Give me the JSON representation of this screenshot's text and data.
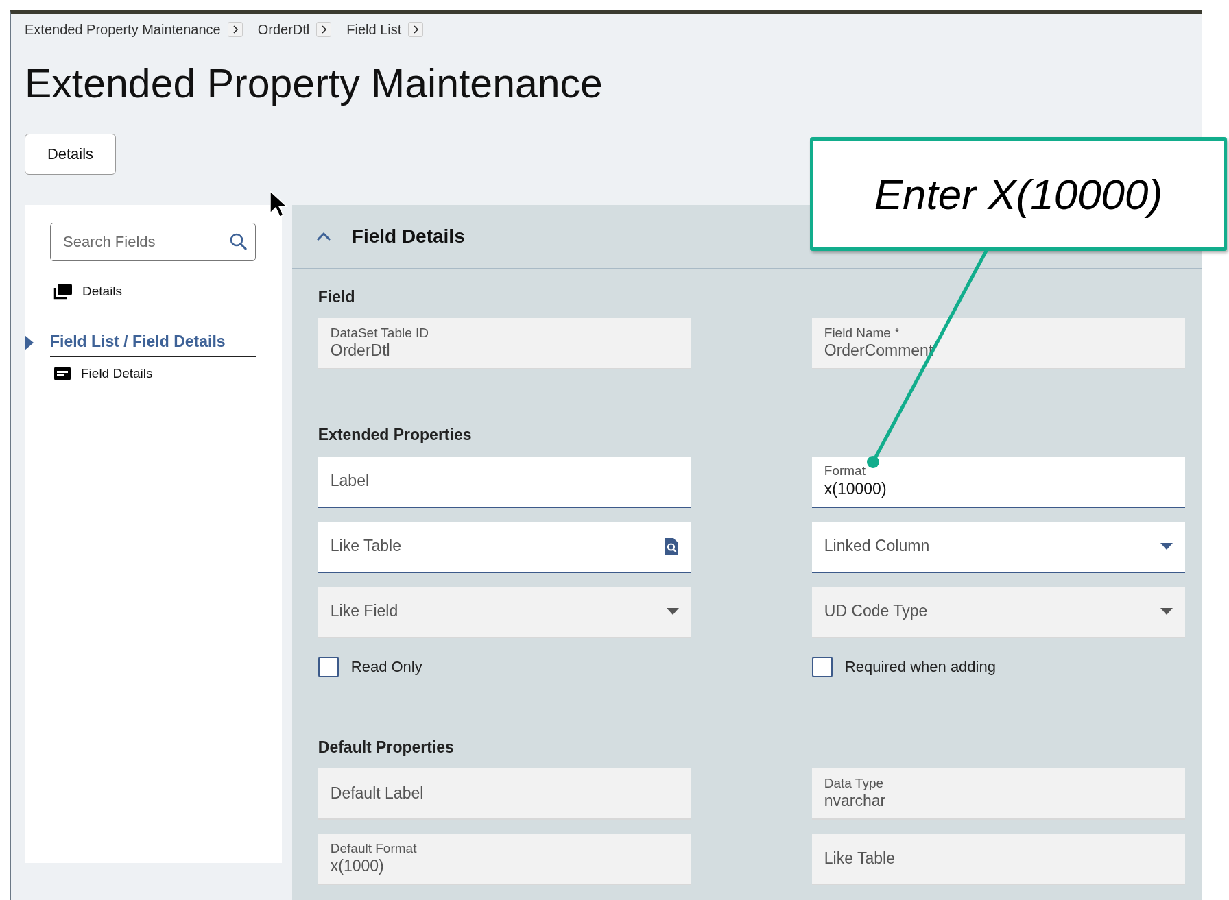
{
  "breadcrumbs": [
    {
      "label": "Extended Property Maintenance"
    },
    {
      "label": "OrderDtl"
    },
    {
      "label": "Field List"
    }
  ],
  "page_title": "Extended Property Maintenance",
  "details_button": "Details",
  "sidebar": {
    "search": {
      "placeholder": "Search Fields"
    },
    "items": [
      {
        "kind": "link",
        "label": "Details"
      },
      {
        "kind": "group",
        "label": "Field List / Field Details",
        "selected": true,
        "children": [
          {
            "kind": "form",
            "label": "Field Details"
          }
        ]
      }
    ]
  },
  "panel": {
    "title": "Field Details",
    "expanded": true,
    "sections": [
      {
        "title": "Field",
        "fields": [
          {
            "kind": "text",
            "label": "DataSet Table ID",
            "value": "OrderDtl",
            "disabled": true
          },
          {
            "kind": "text",
            "label": "Field Name *",
            "value": "OrderComment",
            "disabled": true
          }
        ]
      },
      {
        "title": "Extended Properties",
        "fields": [
          {
            "kind": "text",
            "placeholder": "Label",
            "disabled": false
          },
          {
            "kind": "text",
            "label": "Format",
            "value": "x(10000)",
            "disabled": false
          },
          {
            "kind": "lookup",
            "placeholder": "Like Table",
            "disabled": false
          },
          {
            "kind": "dropdown",
            "placeholder": "Linked Column",
            "disabled": false
          },
          {
            "kind": "dropdown",
            "placeholder": "Like Field",
            "disabled": true
          },
          {
            "kind": "dropdown",
            "placeholder": "UD Code Type",
            "disabled": true
          },
          {
            "kind": "checkbox",
            "label": "Read Only",
            "checked": false
          },
          {
            "kind": "checkbox",
            "label": "Required when adding",
            "checked": false
          }
        ]
      },
      {
        "title": "Default Properties",
        "fields": [
          {
            "kind": "text",
            "placeholder": "Default Label",
            "disabled": true
          },
          {
            "kind": "text",
            "label": "Data Type",
            "value": "nvarchar",
            "disabled": true
          },
          {
            "kind": "text",
            "label": "Default Format",
            "value": "x(1000)",
            "disabled": true
          },
          {
            "kind": "text",
            "placeholder": "Like Table",
            "disabled": true
          }
        ]
      }
    ]
  },
  "callout": {
    "text": "Enter X(10000)"
  }
}
